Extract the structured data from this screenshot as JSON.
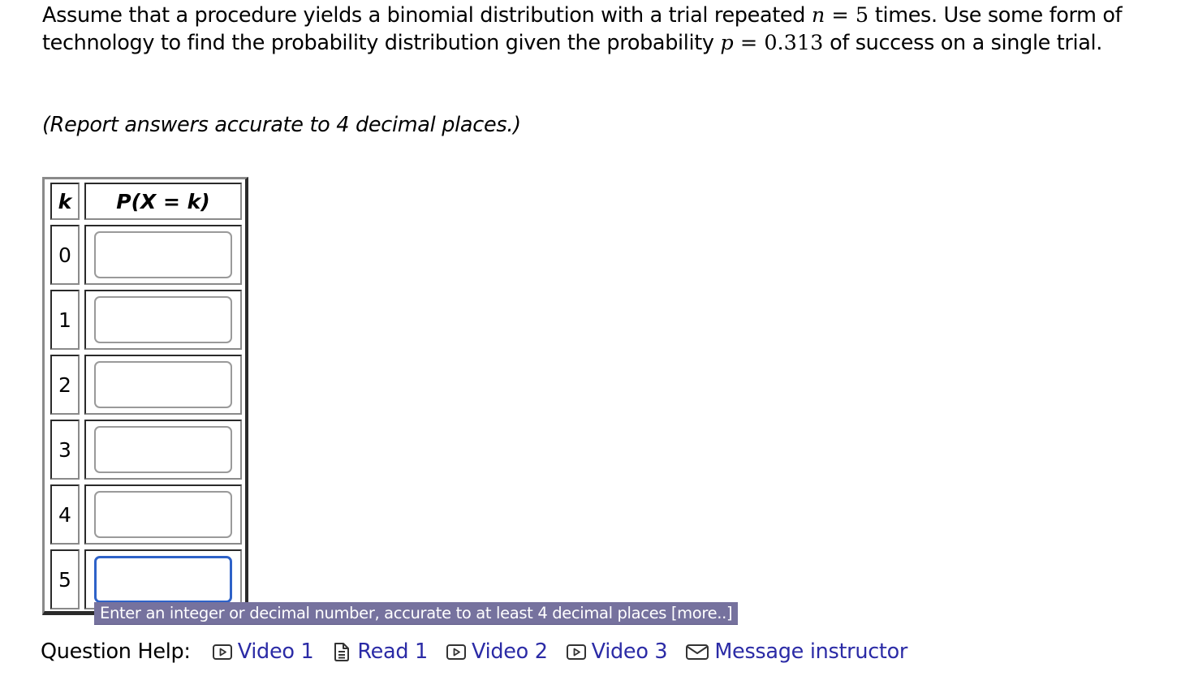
{
  "question": {
    "text_part1": "Assume that a procedure yields a binomial distribution with a trial repeated ",
    "n_var": "n",
    "n_eq": " = ",
    "n_val": "5",
    "text_part2": " times. Use some form of technology to find the probability distribution given the probability ",
    "p_var": "p",
    "p_eq": " = ",
    "p_val": "0.313",
    "text_part3": " of success on a single trial.",
    "instruction": "(Report answers accurate to 4 decimal places.)"
  },
  "table": {
    "header_k": "k",
    "header_p": "P(X = k)",
    "rows": [
      {
        "k": "0",
        "value": "",
        "placeholder": ""
      },
      {
        "k": "1",
        "value": "",
        "placeholder": ""
      },
      {
        "k": "2",
        "value": "",
        "placeholder": ""
      },
      {
        "k": "3",
        "value": "",
        "placeholder": ""
      },
      {
        "k": "4",
        "value": "",
        "placeholder": ""
      },
      {
        "k": "5",
        "value": "",
        "placeholder": ""
      }
    ],
    "focused_row": "5"
  },
  "tooltip": {
    "text": "Enter an integer or decimal number, accurate to at least 4 decimal places ",
    "more": "[more..]"
  },
  "help": {
    "label": "Question Help:",
    "links": [
      {
        "label": "Video 1",
        "icon": "video-icon"
      },
      {
        "label": "Read 1",
        "icon": "document-icon"
      },
      {
        "label": "Video 2",
        "icon": "video-icon"
      },
      {
        "label": "Video 3",
        "icon": "video-icon"
      },
      {
        "label": "Message instructor",
        "icon": "mail-icon"
      }
    ]
  },
  "colors": {
    "link": "#2b2ba6",
    "focus": "#2e62c8",
    "tooltip_bg": "#76729e"
  }
}
